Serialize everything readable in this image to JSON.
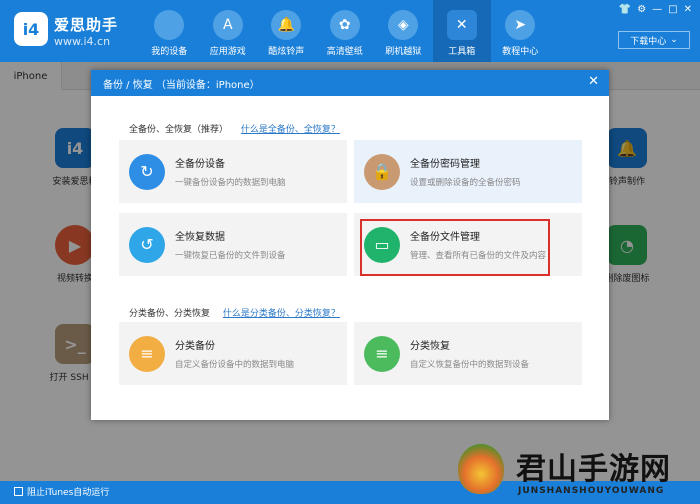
{
  "app": {
    "brand": "爱思助手",
    "url": "www.i4.cn",
    "logo_text": "i4"
  },
  "nav": [
    {
      "label": "我的设备",
      "icon": "apple-icon"
    },
    {
      "label": "应用游戏",
      "icon": "app-store-icon"
    },
    {
      "label": "酷炫铃声",
      "icon": "bell-icon"
    },
    {
      "label": "高清壁纸",
      "icon": "flower-icon"
    },
    {
      "label": "刷机越狱",
      "icon": "dropbox-icon"
    },
    {
      "label": "工具箱",
      "icon": "tools-icon",
      "active": true
    },
    {
      "label": "教程中心",
      "icon": "compass-icon"
    }
  ],
  "download_center": "下载中心",
  "device_tab": "iPhone",
  "background_tools": [
    {
      "label": "安装爱思移",
      "color": "#1a7fd8",
      "glyph": "i4"
    },
    {
      "label": "视频转换",
      "color": "#e9603b",
      "glyph": "▶"
    },
    {
      "label": "打开 SSH 通",
      "color": "#b79e7c",
      "glyph": ">_"
    },
    {
      "label": "铃声制作",
      "color": "#1a7fd8",
      "glyph": "🔔"
    },
    {
      "label": "删除废图标",
      "color": "#2fb25a",
      "glyph": "◔"
    }
  ],
  "dialog": {
    "title": "备份 / 恢复 （当前设备：iPhone）",
    "section1_title": "全备份、全恢复（推荐）",
    "section1_link": "什么是全备份、全恢复？",
    "section2_title": "分类备份、分类恢复",
    "section2_link": "什么是分类备份、分类恢复？",
    "cards": [
      {
        "title": "全备份设备",
        "desc": "一键备份设备内的数据到电脑",
        "color": "#2e8ee6"
      },
      {
        "title": "全备份密码管理",
        "desc": "设置或删除设备的全备份密码",
        "color": "#c99a72"
      },
      {
        "title": "全恢复数据",
        "desc": "一键恢复已备份的文件到设备",
        "color": "#2ea6e8"
      },
      {
        "title": "全备份文件管理",
        "desc": "管理、查看所有已备份的文件及内容",
        "color": "#1fb36b"
      },
      {
        "title": "分类备份",
        "desc": "自定义备份设备中的数据到电脑",
        "color": "#f2ad43"
      },
      {
        "title": "分类恢复",
        "desc": "自定义恢复备份中的数据到设备",
        "color": "#4cbb5e"
      }
    ]
  },
  "status": {
    "itunes_label": "阻止iTunes自动运行"
  },
  "watermark": {
    "title": "君山手游网",
    "sub": "JUNSHANSHOUYOUWANG"
  }
}
